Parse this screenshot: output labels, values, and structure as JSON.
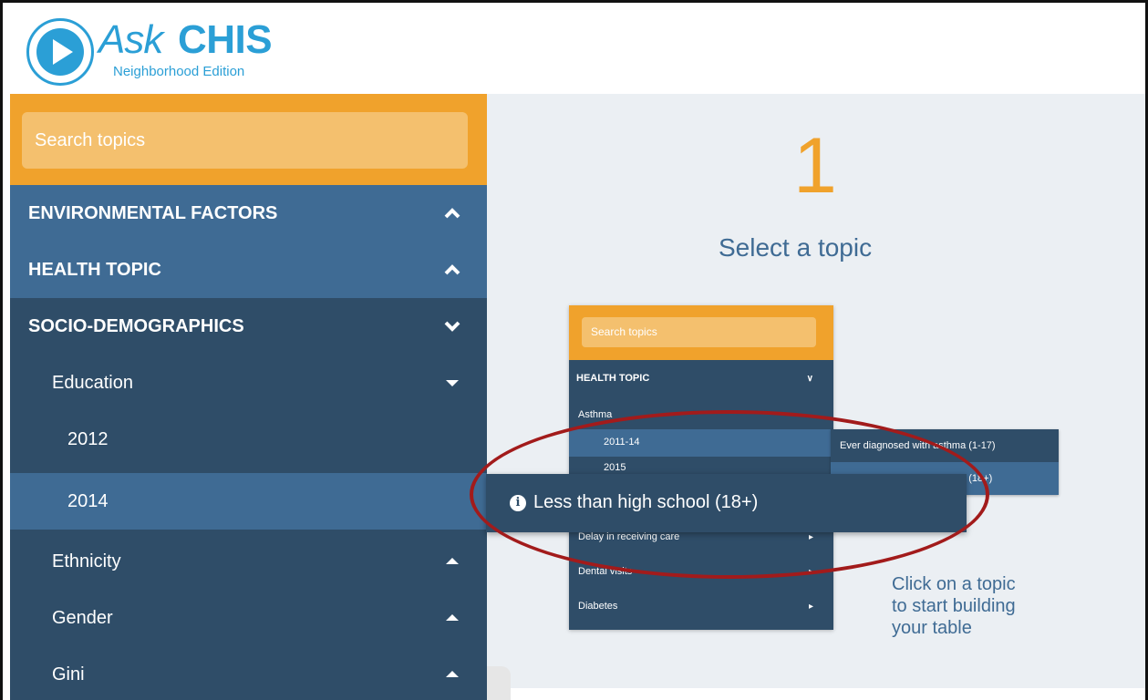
{
  "header": {
    "logo_ask": "Ask",
    "logo_chis": "CHIS",
    "logo_subtitle": "Neighborhood Edition"
  },
  "search": {
    "placeholder": "Search topics"
  },
  "categories": [
    {
      "label": "ENVIRONMENTAL FACTORS",
      "state": "collapsed"
    },
    {
      "label": "HEALTH TOPIC",
      "state": "collapsed"
    },
    {
      "label": "SOCIO-DEMOGRAPHICS",
      "state": "expanded"
    }
  ],
  "subtopics": [
    {
      "label": "Education",
      "state": "expanded"
    },
    {
      "label": "Ethnicity",
      "state": "collapsed"
    },
    {
      "label": "Gender",
      "state": "collapsed"
    },
    {
      "label": "Gini",
      "state": "collapsed"
    }
  ],
  "years": [
    {
      "label": "2012"
    },
    {
      "label": "2014",
      "selected": true
    }
  ],
  "popup": {
    "text": "Less than high school (18+)"
  },
  "main": {
    "step_number": "1",
    "step_title": "Select a topic",
    "callout": [
      "Click on a topic",
      "to start building",
      "your table"
    ]
  },
  "mini": {
    "search_placeholder": "Search topics",
    "category": "HEALTH TOPIC",
    "items": [
      "Asthma",
      "2011-14",
      "2015",
      "Delay in receiving care",
      "Dental visits",
      "Diabetes"
    ],
    "popup_items": [
      "Ever diagnosed with asthma (1-17)",
      "Ever diagnosed with asthma (18+)"
    ]
  },
  "colors": {
    "accent_orange": "#f0a22c",
    "sidebar_dark": "#2f4d68",
    "sidebar_light": "#3f6b94",
    "logo_blue": "#2b9fd6",
    "highlight_red": "#a21b1b"
  }
}
